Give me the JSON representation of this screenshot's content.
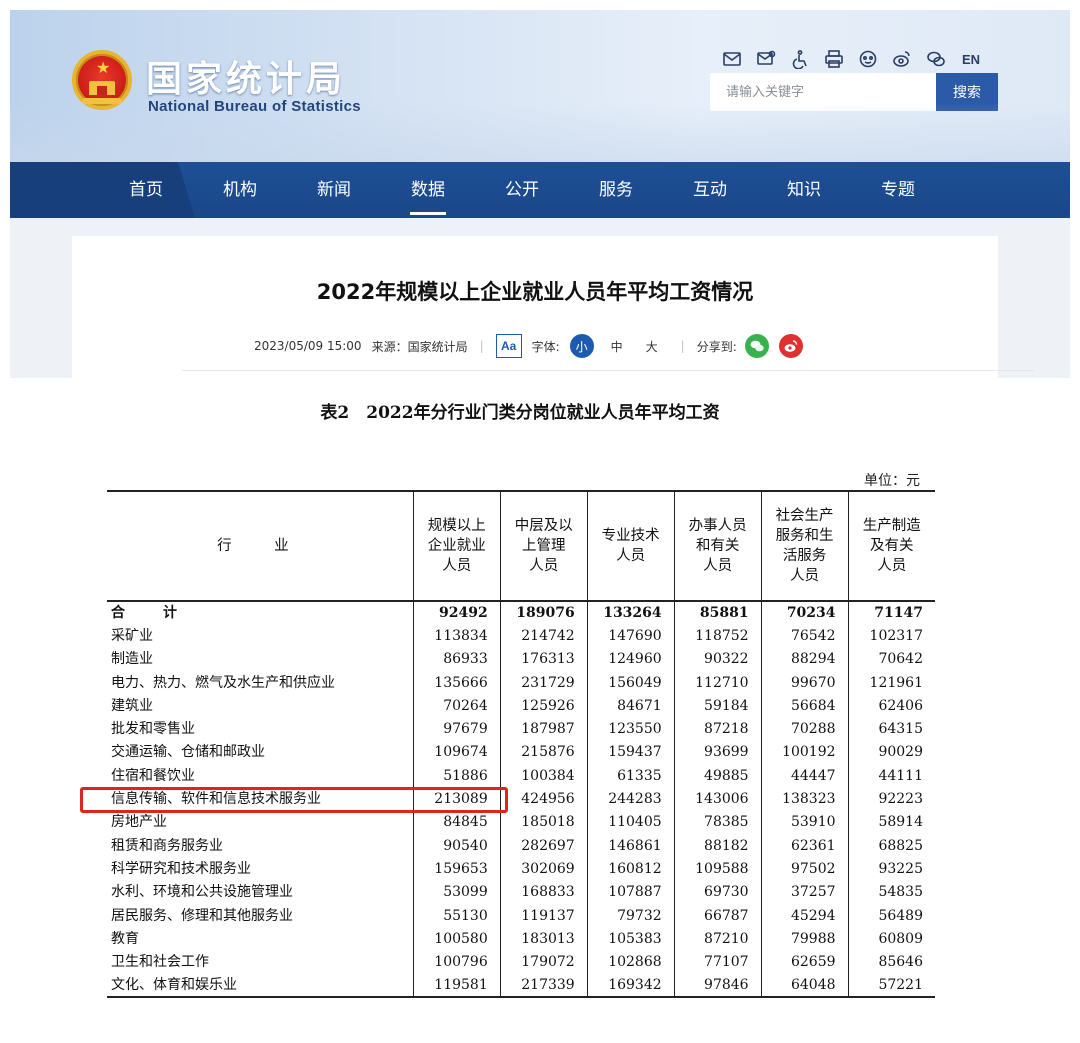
{
  "header": {
    "title_cn": "国家统计局",
    "title_en": "National Bureau of Statistics",
    "search_placeholder": "请输入关键字",
    "search_button": "搜索",
    "language": "EN"
  },
  "nav": {
    "items": [
      {
        "label": "首页"
      },
      {
        "label": "机构"
      },
      {
        "label": "新闻"
      },
      {
        "label": "数据",
        "active": true
      },
      {
        "label": "公开"
      },
      {
        "label": "服务"
      },
      {
        "label": "互动"
      },
      {
        "label": "知识"
      },
      {
        "label": "专题"
      }
    ]
  },
  "article": {
    "title": "2022年规模以上企业就业人员年平均工资情况",
    "datetime": "2023/05/09 15:00",
    "source": "来源：国家统计局",
    "font_label": "字体:",
    "font_sizes": [
      "小",
      "中",
      "大"
    ],
    "font_icon": "Aa",
    "share_label": "分享到:"
  },
  "table": {
    "title": "表2　2022年分行业门类分岗位就业人员年平均工资",
    "unit": "单位：元",
    "headers": [
      "行　业",
      "规模以上企业就业人员",
      "中层及以上管理人员",
      "专业技术人员",
      "办事人员和有关人员",
      "社会生产服务和生活服务人员",
      "生产制造及有关人员"
    ],
    "headers_display": [
      [
        "行　业"
      ],
      [
        "规模以上",
        "企业就业",
        "人员"
      ],
      [
        "中层及以",
        "上管理",
        "人员"
      ],
      [
        "专业技术",
        "人员"
      ],
      [
        "办事人员",
        "和有关",
        "人员"
      ],
      [
        "社会生产",
        "服务和生",
        "活服务",
        "人员"
      ],
      [
        "生产制造",
        "及有关",
        "人员"
      ]
    ],
    "rows": [
      {
        "industry": "合　计",
        "values": [
          "92492",
          "189076",
          "133264",
          "85881",
          "70234",
          "71147"
        ],
        "total": true
      },
      {
        "industry": "采矿业",
        "values": [
          "113834",
          "214742",
          "147690",
          "118752",
          "76542",
          "102317"
        ]
      },
      {
        "industry": "制造业",
        "values": [
          "86933",
          "176313",
          "124960",
          "90322",
          "88294",
          "70642"
        ]
      },
      {
        "industry": "电力、热力、燃气及水生产和供应业",
        "values": [
          "135666",
          "231729",
          "156049",
          "112710",
          "99670",
          "121961"
        ]
      },
      {
        "industry": "建筑业",
        "values": [
          "70264",
          "125926",
          "84671",
          "59184",
          "56684",
          "62406"
        ]
      },
      {
        "industry": "批发和零售业",
        "values": [
          "97679",
          "187987",
          "123550",
          "87218",
          "70288",
          "64315"
        ]
      },
      {
        "industry": "交通运输、仓储和邮政业",
        "values": [
          "109674",
          "215876",
          "159437",
          "93699",
          "100192",
          "90029"
        ]
      },
      {
        "industry": "住宿和餐饮业",
        "values": [
          "51886",
          "100384",
          "61335",
          "49885",
          "44447",
          "44111"
        ]
      },
      {
        "industry": "信息传输、软件和信息技术服务业",
        "values": [
          "213089",
          "424956",
          "244283",
          "143006",
          "138323",
          "92223"
        ],
        "highlighted": true
      },
      {
        "industry": "房地产业",
        "values": [
          "84845",
          "185018",
          "110405",
          "78385",
          "53910",
          "58914"
        ]
      },
      {
        "industry": "租赁和商务服务业",
        "values": [
          "90540",
          "282697",
          "146861",
          "88182",
          "62361",
          "68825"
        ]
      },
      {
        "industry": "科学研究和技术服务业",
        "values": [
          "159653",
          "302069",
          "160812",
          "109588",
          "97502",
          "93225"
        ]
      },
      {
        "industry": "水利、环境和公共设施管理业",
        "values": [
          "53099",
          "168833",
          "107887",
          "69730",
          "37257",
          "54835"
        ]
      },
      {
        "industry": "居民服务、修理和其他服务业",
        "values": [
          "55130",
          "119137",
          "79732",
          "66787",
          "45294",
          "56489"
        ]
      },
      {
        "industry": "教育",
        "values": [
          "100580",
          "183013",
          "105383",
          "87210",
          "79988",
          "60809"
        ]
      },
      {
        "industry": "卫生和社会工作",
        "values": [
          "100796",
          "179072",
          "102868",
          "77107",
          "62659",
          "85646"
        ]
      },
      {
        "industry": "文化、体育和娱乐业",
        "values": [
          "119581",
          "217339",
          "169342",
          "97846",
          "64048",
          "57221"
        ]
      }
    ]
  },
  "colors": {
    "nav_bg": "#1e4f95",
    "accent": "#1d5bb0",
    "highlight": "#e0241b"
  }
}
